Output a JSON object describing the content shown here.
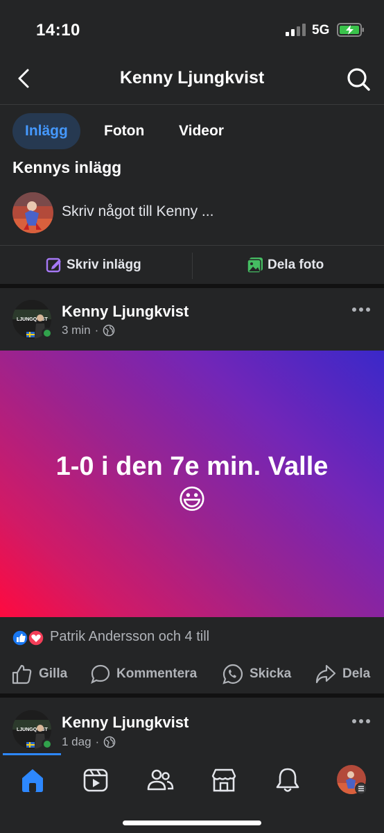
{
  "status": {
    "time": "14:10",
    "network": "5G"
  },
  "header": {
    "title": "Kenny Ljungkvist"
  },
  "tabs": [
    {
      "label": "Inlägg"
    },
    {
      "label": "Foton"
    },
    {
      "label": "Videor"
    }
  ],
  "section": {
    "title": "Kennys inlägg"
  },
  "composer": {
    "placeholder": "Skriv något till Kenny ..."
  },
  "actions": {
    "write": "Skriv inlägg",
    "photo": "Dela foto"
  },
  "posts": [
    {
      "author": "Kenny Ljungkvist",
      "time": "3 min",
      "text": "1-0 i den 7e min. Valle",
      "emoji": "😃",
      "reactions": "Patrik Andersson och 4 till",
      "buttons": {
        "like": "Gilla",
        "comment": "Kommentera",
        "send": "Skicka",
        "share": "Dela"
      }
    },
    {
      "author": "Kenny Ljungkvist",
      "time": "1 dag"
    }
  ],
  "colors": {
    "accent": "#2d88ff",
    "background": "#242526",
    "online": "#31a24c"
  }
}
